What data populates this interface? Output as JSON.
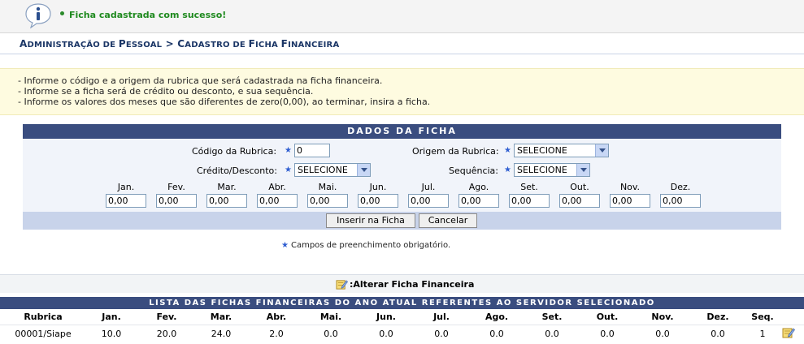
{
  "message": {
    "text": "Ficha cadastrada com sucesso!"
  },
  "breadcrumb": {
    "part1_first": "A",
    "part1_rest": "DMINISTRAÇÃO DE ",
    "part1b_first": "P",
    "part1b_rest": "ESSOAL",
    "separator": " > ",
    "part2_first": "C",
    "part2_rest": "ADASTRO DE ",
    "part2b_first": "F",
    "part2b_rest": "ICHA ",
    "part2c_first": "F",
    "part2c_rest": "INANCEIRA"
  },
  "instructions": [
    "- Informe o código e a origem da rubrica que será cadastrada na ficha financeira.",
    "- Informe se a ficha será de crédito ou desconto, e sua sequência.",
    "- Informe os valores dos meses que são diferentes de zero(0,00), ao terminar, insira a ficha."
  ],
  "form": {
    "title": "DADOS DA FICHA",
    "codigo_label": "Código da Rubrica:",
    "codigo_value": "0",
    "origem_label": "Origem da Rubrica:",
    "origem_value": "SELECIONE",
    "credito_label": "Crédito/Desconto:",
    "credito_value": "SELECIONE",
    "sequencia_label": "Sequência:",
    "sequencia_value": "SELECIONE",
    "months": [
      "Jan.",
      "Fev.",
      "Mar.",
      "Abr.",
      "Mai.",
      "Jun.",
      "Jul.",
      "Ago.",
      "Set.",
      "Out.",
      "Nov.",
      "Dez."
    ],
    "month_values": [
      "0,00",
      "0,00",
      "0,00",
      "0,00",
      "0,00",
      "0,00",
      "0,00",
      "0,00",
      "0,00",
      "0,00",
      "0,00",
      "0,00"
    ],
    "insert_button": "Inserir na Ficha",
    "cancel_button": "Cancelar"
  },
  "required_note": "Campos de preenchimento obrigatório.",
  "alter_link": ":Alterar Ficha Financeira",
  "list": {
    "title": "LISTA DAS FICHAS FINANCEIRAS DO ANO ATUAL REFERENTES AO SERVIDOR SELECIONADO",
    "headers": [
      "Rubrica",
      "Jan.",
      "Fev.",
      "Mar.",
      "Abr.",
      "Mai.",
      "Jun.",
      "Jul.",
      "Ago.",
      "Set.",
      "Out.",
      "Nov.",
      "Dez.",
      "Seq."
    ],
    "rows": [
      [
        "00001/Siape",
        "10.0",
        "20.0",
        "24.0",
        "2.0",
        "0.0",
        "0.0",
        "0.0",
        "0.0",
        "0.0",
        "0.0",
        "0.0",
        "0.0",
        "1"
      ]
    ]
  },
  "icons": {
    "message": "info-icon",
    "alter": "edit-note-icon",
    "row_action": "edit-note-icon"
  },
  "colors": {
    "header_bar": "#3a4d7f",
    "success_text": "#1f8a1f",
    "breadcrumb": "#1b3666",
    "required_star": "#2f5ed1"
  }
}
